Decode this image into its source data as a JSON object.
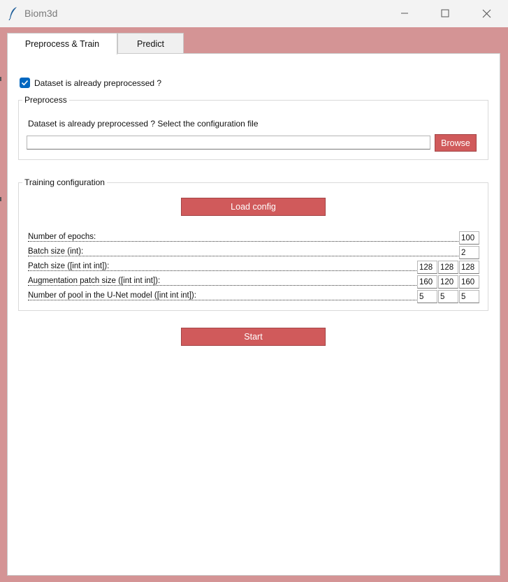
{
  "window": {
    "title": "Biom3d",
    "feather_icon": "feather-icon",
    "minimize_icon": "minimize-icon",
    "maximize_icon": "maximize-icon",
    "close_icon": "close-icon"
  },
  "colors": {
    "accent": "#d05a5b",
    "background": "#d49495",
    "checkbox": "#0067c0"
  },
  "tabs": [
    {
      "label": "Preprocess & Train",
      "active": true
    },
    {
      "label": "Predict",
      "active": false
    }
  ],
  "dataset_checkbox": {
    "label": "Dataset is already preprocessed ?",
    "checked": true
  },
  "preprocess": {
    "title": "Preprocess",
    "instruction": "Dataset is already preprocessed ? Select the configuration file",
    "file_path": "",
    "browse_label": "Browse"
  },
  "training": {
    "title": "Training configuration",
    "load_config_label": "Load config",
    "params": [
      {
        "label": "Number of epochs:",
        "values": [
          "100"
        ]
      },
      {
        "label": "Batch size (int):",
        "values": [
          "2"
        ]
      },
      {
        "label": "Patch size ([int int int]):",
        "values": [
          "128",
          "128",
          "128"
        ]
      },
      {
        "label": "Augmentation patch size ([int int int]):",
        "values": [
          "160",
          "120",
          "160"
        ]
      },
      {
        "label": "Number of pool in the U-Net model ([int int int]):",
        "values": [
          "5",
          "5",
          "5"
        ]
      }
    ]
  },
  "start_label": "Start"
}
